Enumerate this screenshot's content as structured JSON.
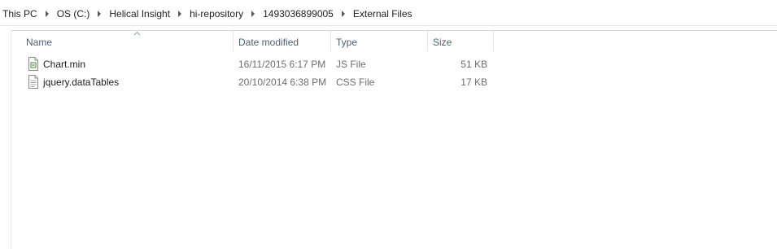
{
  "breadcrumb": {
    "items": [
      "This PC",
      "OS (C:)",
      "Helical Insight",
      "hi-repository",
      "1493036899005",
      "External Files"
    ]
  },
  "columns": {
    "name": "Name",
    "date_modified": "Date modified",
    "type": "Type",
    "size": "Size",
    "sort_indicator": "ascending"
  },
  "files": [
    {
      "name": "Chart.min",
      "date_modified": "16/11/2015 6:17 PM",
      "type": "JS File",
      "size": "51 KB",
      "icon": "js-file-icon"
    },
    {
      "name": "jquery.dataTables",
      "date_modified": "20/10/2014 6:38 PM",
      "type": "CSS File",
      "size": "17 KB",
      "icon": "css-file-icon"
    }
  ],
  "colors": {
    "header_text": "#4c607a",
    "secondary_text": "#6d6d6d",
    "primary_text": "#1e1e1e"
  }
}
